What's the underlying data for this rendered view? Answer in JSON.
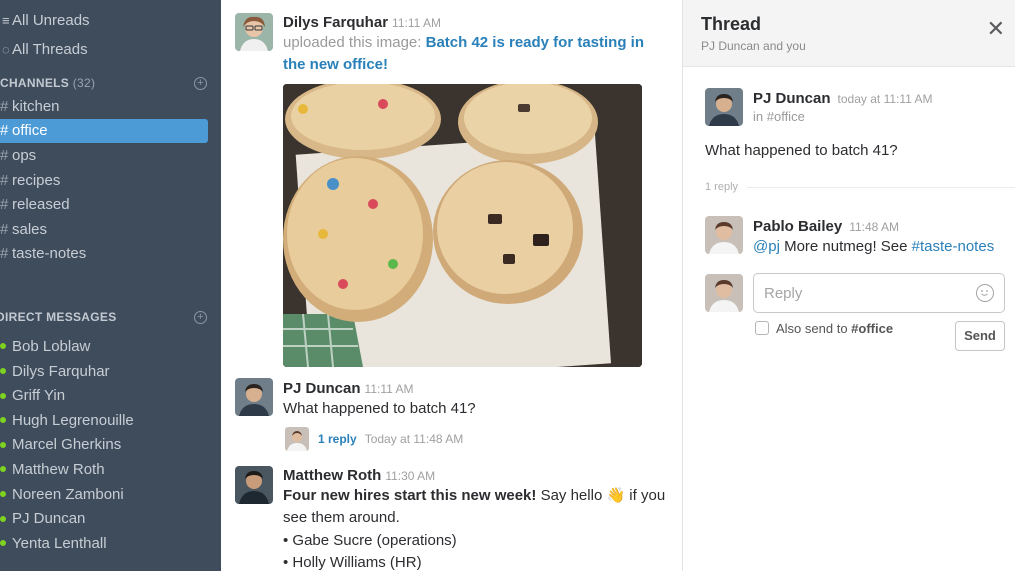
{
  "sidebar": {
    "top_items": [
      {
        "label": "All Unreads",
        "icon": "unreads-icon"
      },
      {
        "label": "All Threads",
        "icon": "threads-icon"
      }
    ],
    "channels_header": "CHANNELS",
    "channels_count": "(32)",
    "channels": [
      "kitchen",
      "office",
      "ops",
      "recipes",
      "released",
      "sales",
      "taste-notes"
    ],
    "active_channel": "office",
    "dm_header": "DIRECT MESSAGES",
    "direct_messages": [
      "Bob Loblaw",
      "Dilys Farquhar",
      "Griff Yin",
      "Hugh Legrenouille",
      "Marcel Gherkins",
      "Matthew Roth",
      "Noreen Zamboni",
      "PJ Duncan",
      "Yenta Lenthall"
    ],
    "colors": {
      "background": "#3f4c5c",
      "active": "#4c9ad6",
      "online": "#7ed321"
    }
  },
  "messages": {
    "m1": {
      "author": "Dilys Farquhar",
      "time": "11:11 AM",
      "prefix": "uploaded this image:",
      "link": "Batch 42 is ready for tasting in the new office!"
    },
    "m2": {
      "author": "PJ Duncan",
      "time": "11:11 AM",
      "text": "What happened to batch 41?",
      "reply_count": "1 reply",
      "reply_time": "Today at 11:48 AM"
    },
    "m3": {
      "author": "Matthew Roth",
      "time": "11:30 AM",
      "text_bold": "Four new hires start this new week!",
      "text_rest": " Say hello ",
      "text_end": " if you",
      "text_line2": "see them around.",
      "bullets": [
        "Gabe Sucre (operations)",
        "Holly Williams (HR)"
      ],
      "emoji": "👋"
    }
  },
  "thread": {
    "title": "Thread",
    "subtitle": "PJ Duncan and you",
    "close_icon": "close-icon",
    "parent": {
      "author": "PJ Duncan",
      "time": "today at 11:11 AM",
      "channel": "in #office",
      "text": "What happened to batch 41?"
    },
    "reply_count": "1 reply",
    "reply": {
      "author": "Pablo Bailey",
      "time": "11:48 AM",
      "mention": "@pj",
      "text": " More nutmeg! See ",
      "channel_link": "#taste-notes"
    },
    "composer": {
      "placeholder": "Reply",
      "also_send_prefix": "Also send to ",
      "also_send_channel": "#office",
      "send_label": "Send"
    }
  }
}
